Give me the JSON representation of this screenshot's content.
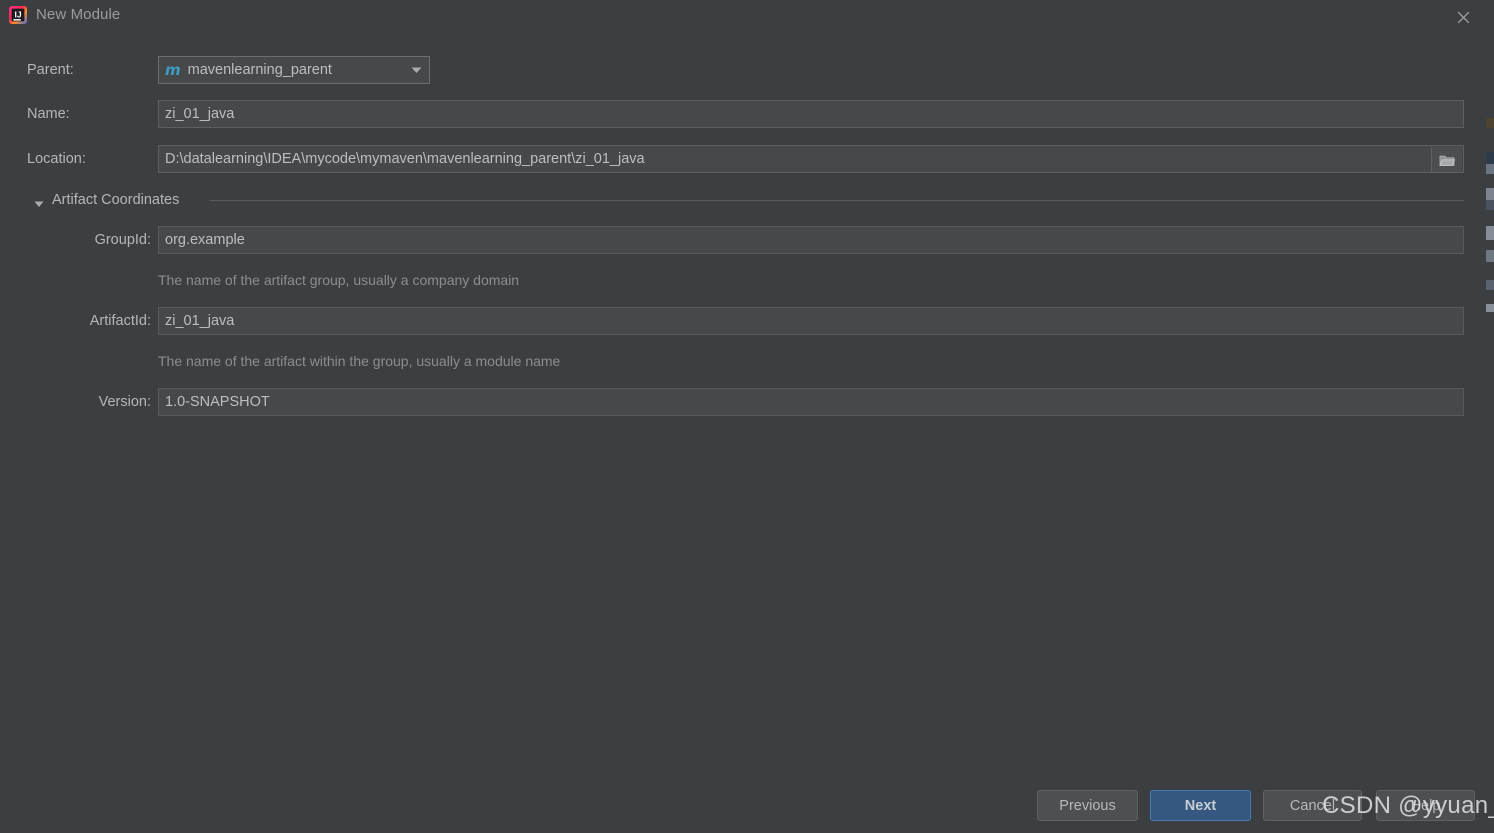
{
  "window": {
    "title": "New Module",
    "app_icon": "intellij-idea-icon",
    "close_icon": "close-icon"
  },
  "form": {
    "parent": {
      "label": "Parent:",
      "value": "mavenlearning_parent",
      "icon": "maven-module-icon",
      "dropdown_icon": "chevron-down-icon"
    },
    "name": {
      "label": "Name:",
      "value": "zi_01_java"
    },
    "location": {
      "label": "Location:",
      "value": "D:\\datalearning\\IDEA\\mycode\\mymaven\\mavenlearning_parent\\zi_01_java",
      "browse_icon": "folder-icon"
    }
  },
  "artifact_coordinates": {
    "title": "Artifact Coordinates",
    "collapse_icon": "triangle-down-icon",
    "group_id": {
      "label": "GroupId:",
      "value": "org.example",
      "hint": "The name of the artifact group, usually a company domain"
    },
    "artifact_id": {
      "label": "ArtifactId:",
      "value": "zi_01_java",
      "hint": "The name of the artifact within the group, usually a module name"
    },
    "version": {
      "label": "Version:",
      "value": "1.0-SNAPSHOT"
    }
  },
  "buttons": {
    "previous": "Previous",
    "next": "Next",
    "cancel": "Cancel",
    "help": "Help"
  },
  "watermark": {
    "text": "CSDN @yyuan_in"
  },
  "colors": {
    "dialog_bg": "#3c3f41",
    "field_bg": "#45494a",
    "text": "#bbbbbb",
    "hint_text": "#8b8d8f",
    "primary_button_bg": "#365880",
    "maven_icon": "#3d9cc4"
  }
}
